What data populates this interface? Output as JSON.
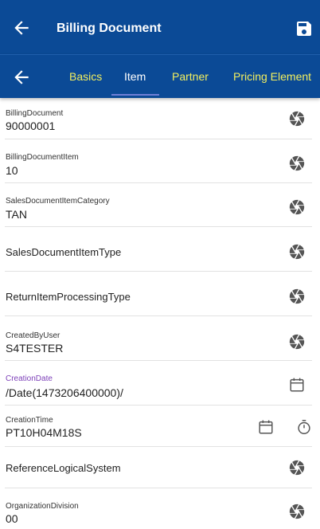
{
  "appbar": {
    "title": "Billing Document",
    "back_icon": "arrow-left-icon",
    "save_icon": "save-icon"
  },
  "tabs": [
    {
      "label": "Basics",
      "active": false
    },
    {
      "label": "Item",
      "active": true
    },
    {
      "label": "Partner",
      "active": false
    },
    {
      "label": "Pricing Element",
      "active": false
    }
  ],
  "fields": [
    {
      "label": "BillingDocument",
      "value": "90000001"
    },
    {
      "label": "BillingDocumentItem",
      "value": "10"
    },
    {
      "label": "SalesDocumentItemCategory",
      "value": "TAN"
    },
    {
      "label": "SalesDocumentItemType",
      "value": ""
    },
    {
      "label": "ReturnItemProcessingType",
      "value": ""
    },
    {
      "label": "CreatedByUser",
      "value": "S4TESTER"
    },
    {
      "label": "CreationDate",
      "value": "/Date(1473206400000)/"
    },
    {
      "label": "CreationTime",
      "value": "PT10H04M18S"
    },
    {
      "label": "ReferenceLogicalSystem",
      "value": ""
    },
    {
      "label": "OrganizationDivision",
      "value": "00"
    }
  ],
  "colors": {
    "primary": "#0b4a96",
    "tab_inactive": "#f2ee5f",
    "tab_active": "#ffffff",
    "focused_label": "#7c3fb8",
    "icon": "#555555"
  }
}
